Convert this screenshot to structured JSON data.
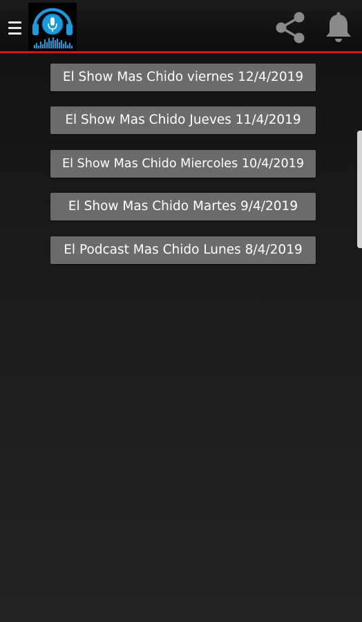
{
  "colors": {
    "accent_divider": "#d11414",
    "button_bg": "#6b6b6b",
    "logo_blue": "#1a9bdf"
  },
  "header": {
    "icons": {
      "menu": "hamburger-menu-icon",
      "logo": "microphone-headphones-logo",
      "share": "share-icon",
      "notifications": "bell-icon"
    }
  },
  "episodes": [
    {
      "label": "El Show Mas Chido viernes 12/4/2019"
    },
    {
      "label": "El Show Mas Chido Jueves 11/4/2019"
    },
    {
      "label": "El Show Mas Chido Miercoles 10/4/2019"
    },
    {
      "label": "El Show Mas Chido Martes 9/4/2019"
    },
    {
      "label": "El Podcast Mas Chido Lunes 8/4/2019"
    }
  ]
}
